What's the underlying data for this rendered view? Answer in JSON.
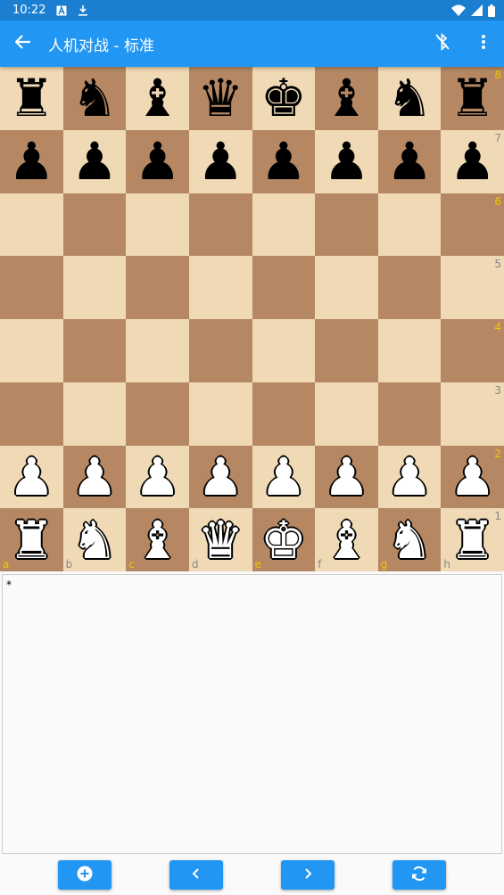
{
  "status_bar": {
    "time": "10:22",
    "icons": [
      "text-a-icon",
      "download-icon",
      "wifi-icon",
      "signal-icon",
      "battery-icon"
    ]
  },
  "app_bar": {
    "title": "人机对战 - 标准",
    "icons": [
      "arrow-back-icon",
      "bluetooth-disabled-icon",
      "more-vert-icon"
    ],
    "color": "#2196f3"
  },
  "board": {
    "light_color": "#f0d9b5",
    "dark_color": "#b58863",
    "rows": [
      [
        "♜",
        "♞",
        "♝",
        "♛",
        "♚",
        "♝",
        "♞",
        "♜"
      ],
      [
        "♟",
        "♟",
        "♟",
        "♟",
        "♟",
        "♟",
        "♟",
        "♟"
      ],
      [
        "",
        "",
        "",
        "",
        "",
        "",
        "",
        ""
      ],
      [
        "",
        "",
        "",
        "",
        "",
        "",
        "",
        ""
      ],
      [
        "",
        "",
        "",
        "",
        "",
        "",
        "",
        ""
      ],
      [
        "",
        "",
        "",
        "",
        "",
        "",
        "",
        ""
      ],
      [
        "♟",
        "♟",
        "♟",
        "♟",
        "♟",
        "♟",
        "♟",
        "♟"
      ],
      [
        "♜",
        "♞",
        "♝",
        "♛",
        "♚",
        "♝",
        "♞",
        "♜"
      ]
    ],
    "colors": [
      [
        "black",
        "black",
        "black",
        "black",
        "black",
        "black",
        "black",
        "black"
      ],
      [
        "black",
        "black",
        "black",
        "black",
        "black",
        "black",
        "black",
        "black"
      ],
      [
        "",
        "",
        "",
        "",
        "",
        "",
        "",
        ""
      ],
      [
        "",
        "",
        "",
        "",
        "",
        "",
        "",
        ""
      ],
      [
        "",
        "",
        "",
        "",
        "",
        "",
        "",
        ""
      ],
      [
        "",
        "",
        "",
        "",
        "",
        "",
        "",
        ""
      ],
      [
        "white",
        "white",
        "white",
        "white",
        "white",
        "white",
        "white",
        "white"
      ],
      [
        "white",
        "white",
        "white",
        "white",
        "white",
        "white",
        "white",
        "white"
      ]
    ],
    "ranks": [
      "8",
      "7",
      "6",
      "5",
      "4",
      "3",
      "2",
      "1"
    ],
    "files": [
      "a",
      "b",
      "c",
      "d",
      "e",
      "f",
      "g",
      "h"
    ]
  },
  "move_panel": {
    "text": "*"
  },
  "bottom_bar": {
    "buttons": [
      "add-circle-icon",
      "chevron-left-icon",
      "chevron-right-icon",
      "flip-board-icon"
    ]
  }
}
